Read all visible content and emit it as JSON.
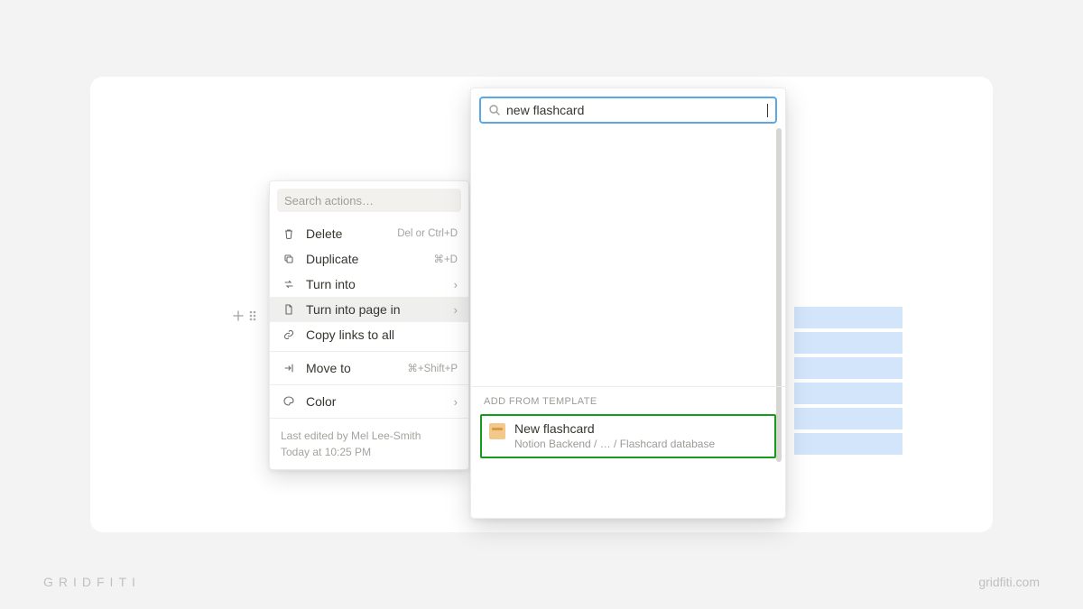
{
  "branding": {
    "left": "GRIDFITI",
    "right": "gridfiti.com"
  },
  "context_menu": {
    "search_placeholder": "Search actions…",
    "items": [
      {
        "label": "Delete",
        "hint": "Del or Ctrl+D",
        "icon": "trash"
      },
      {
        "label": "Duplicate",
        "hint": "⌘+D",
        "icon": "duplicate"
      },
      {
        "label": "Turn into",
        "chevron": true,
        "icon": "turninto"
      },
      {
        "label": "Turn into page in",
        "chevron": true,
        "icon": "page",
        "highlight": true
      },
      {
        "label": "Copy links to all",
        "icon": "link"
      }
    ],
    "move": {
      "label": "Move to",
      "hint": "⌘+Shift+P",
      "icon": "moveto"
    },
    "color": {
      "label": "Color",
      "chevron": true,
      "icon": "color"
    },
    "meta_line1": "Last edited by Mel Lee-Smith",
    "meta_line2": "Today at 10:25 PM"
  },
  "popover": {
    "search_value": "new flashcard",
    "section_label": "ADD FROM TEMPLATE",
    "template": {
      "title": "New flashcard",
      "path": "Notion Backend / … / Flashcard database"
    }
  }
}
